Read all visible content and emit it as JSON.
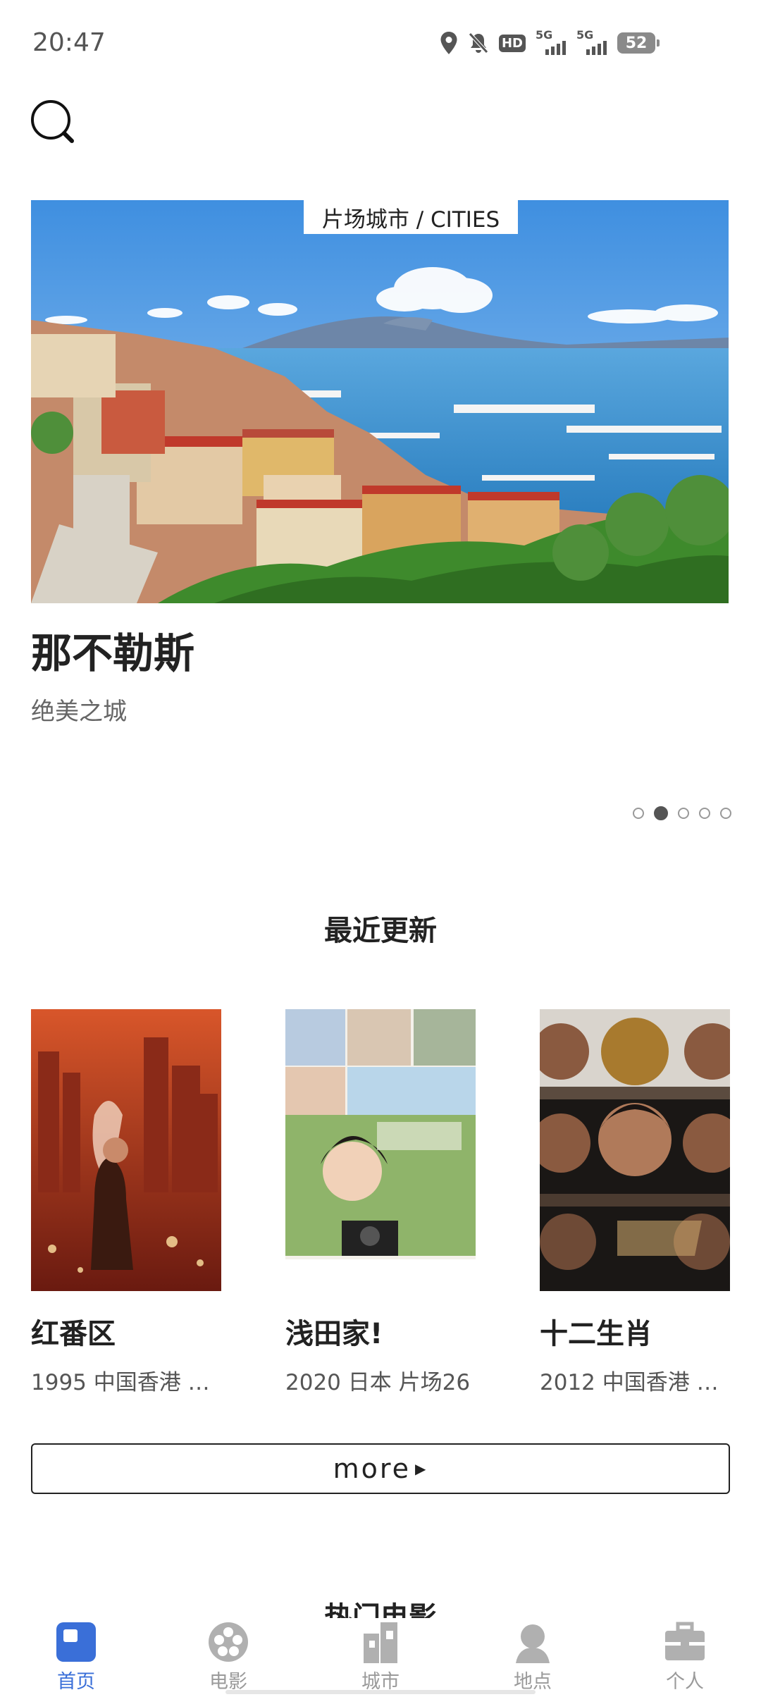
{
  "status": {
    "time": "20:47",
    "battery": "52",
    "net1": "5G",
    "net2": "5G",
    "hd": "HD"
  },
  "banner": {
    "tag": "片场城市 / CITIES",
    "title": "那不勒斯",
    "subtitle": "绝美之城",
    "pages": 5,
    "active_page": 1
  },
  "recent": {
    "title": "最近更新",
    "movies": [
      {
        "title": "红番区",
        "meta": "1995 中国香港 …"
      },
      {
        "title": "浅田家!",
        "meta": "2020 日本 片场26"
      },
      {
        "title": "十二生肖",
        "meta": "2012 中国香港 …"
      }
    ],
    "more_label": "more"
  },
  "next_section_partial": "热门电影",
  "tabs": [
    {
      "label": "首页",
      "icon": "home-icon",
      "active": true
    },
    {
      "label": "电影",
      "icon": "film-reel-icon",
      "active": false
    },
    {
      "label": "城市",
      "icon": "city-icon",
      "active": false
    },
    {
      "label": "地点",
      "icon": "person-pin-icon",
      "active": false
    },
    {
      "label": "个人",
      "icon": "briefcase-icon",
      "active": false
    }
  ],
  "colors": {
    "accent": "#3a6fd8",
    "inactive": "#9a9a9a"
  }
}
